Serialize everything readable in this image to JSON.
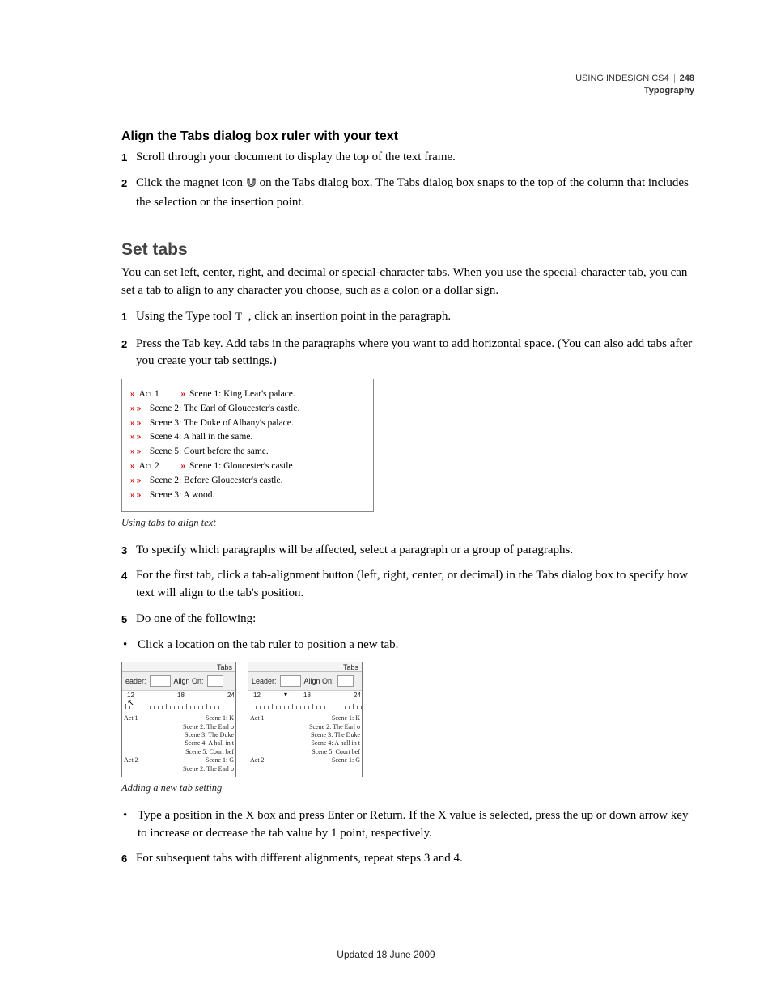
{
  "header": {
    "product": "USING INDESIGN CS4",
    "page_number": "248",
    "section": "Typography"
  },
  "sec_align": {
    "heading": "Align the Tabs dialog box ruler with your text",
    "steps": [
      {
        "n": "1",
        "t": "Scroll through your document to display the top of the text frame."
      },
      {
        "n": "2",
        "a": "Click the magnet icon ",
        "b": " on the Tabs dialog box. The Tabs dialog box snaps to the top of the column that includes the selection or the insertion point."
      }
    ]
  },
  "sec_set": {
    "heading": "Set tabs",
    "intro": "You can set left, center, right, and decimal or special-character tabs. When you use the special-character tab, you can set a tab to align to any character you choose, such as a colon or a dollar sign.",
    "step1": {
      "n": "1",
      "a": "Using the Type tool ",
      "b": " , click an insertion point in the paragraph."
    },
    "step2": {
      "n": "2",
      "t": "Press the Tab key. Add tabs in the paragraphs where you want to add horizontal space. (You can also add tabs after you create your tab settings.)"
    },
    "fig1_caption": "Using tabs to align text",
    "step3": {
      "n": "3",
      "t": "To specify which paragraphs will be affected, select a paragraph or a group of paragraphs."
    },
    "step4": {
      "n": "4",
      "t": "For the first tab, click a tab-alignment button (left, right, center, or decimal) in the Tabs dialog box to specify how text will align to the tab's position."
    },
    "step5": {
      "n": "5",
      "t": "Do one of the following:"
    },
    "bullet_a": "Click a location on the tab ruler to position a new tab.",
    "fig2_caption": "Adding a new tab setting",
    "bullet_b": "Type a position in the X box and press Enter or Return. If the X value is selected, press the up or down arrow key to increase or decrease the tab value by 1 point, respectively.",
    "step6": {
      "n": "6",
      "t": "For subsequent tabs with different alignments, repeat steps 3 and 4."
    }
  },
  "fig1": {
    "glyph": "»",
    "rows": [
      {
        "ind": 1,
        "act": "Act 1",
        "scene": "Scene 1: King Lear's palace.",
        "scene_glyph": true
      },
      {
        "ind": 2,
        "scene": "Scene 2: The Earl of Gloucester's castle."
      },
      {
        "ind": 2,
        "scene": "Scene 3: The Duke of Albany's palace."
      },
      {
        "ind": 2,
        "scene": "Scene 4: A hall in the same."
      },
      {
        "ind": 2,
        "scene": "Scene 5: Court before the same."
      },
      {
        "ind": 1,
        "act": "Act 2",
        "scene": "Scene 1: Gloucester's castle",
        "scene_glyph": true
      },
      {
        "ind": 2,
        "scene": "Scene 2: Before Gloucester's castle."
      },
      {
        "ind": 2,
        "scene": "Scene 3: A wood."
      }
    ]
  },
  "fig2": {
    "panel_title": "Tabs",
    "leader_label_a": "eader:",
    "leader_label_b": "Leader:",
    "align_label": "Align On:",
    "ticks": [
      "12",
      "18",
      "24"
    ],
    "sample": {
      "act1": "Act 1",
      "act2": "Act 2",
      "lines": [
        "Scene 1: K",
        "Scene 2: The Earl o",
        "Scene 3: The Duke",
        "Scene 4: A hall in t",
        "Scene 5: Court bef"
      ],
      "lines2": [
        "Scene 1: G",
        "Scene 2: The Earl o"
      ]
    }
  },
  "footer": "Updated 18 June 2009"
}
